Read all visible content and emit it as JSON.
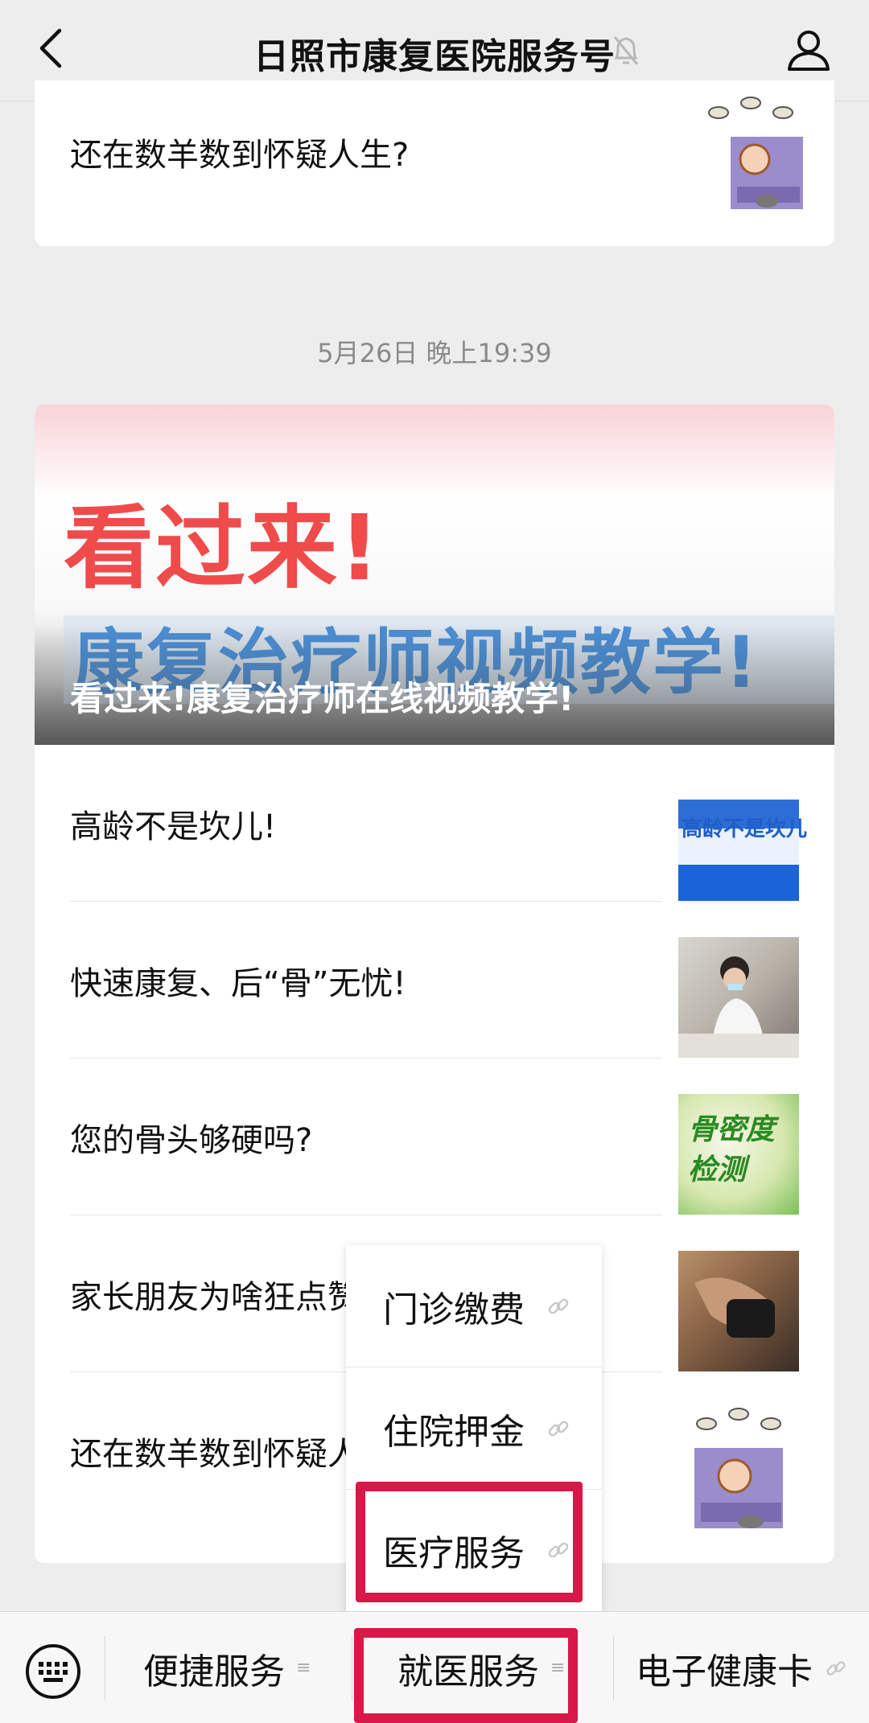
{
  "header": {
    "title": "日照市康复医院服务号"
  },
  "messages": {
    "top_card_title": "还在数羊数到怀疑人生?",
    "timestamp": "5月26日 晚上19:39",
    "cover": {
      "headline1": "看过来!",
      "headline2": "康复治疗师视频教学!",
      "caption": "看过来!康复治疗师在线视频教学!"
    },
    "items": [
      {
        "title": "高龄不是坎儿!",
        "thumb_text": "高龄不是坎儿"
      },
      {
        "title": "快速康复、后“骨”无忧!"
      },
      {
        "title": "您的骨头够硬吗?",
        "thumb_text": "骨密度检测"
      },
      {
        "title": "家长朋友为啥狂点赞"
      },
      {
        "title": "还在数羊数到怀疑人生?"
      }
    ]
  },
  "popup_menu": {
    "items": [
      "门诊缴费",
      "住院押金",
      "医疗服务"
    ],
    "highlighted": "医疗服务"
  },
  "bottom_menu": {
    "items": [
      "便捷服务",
      "就医服务",
      "电子健康卡"
    ],
    "highlighted": "就医服务"
  },
  "colors": {
    "highlight": "#d81848",
    "background": "#ededed"
  }
}
